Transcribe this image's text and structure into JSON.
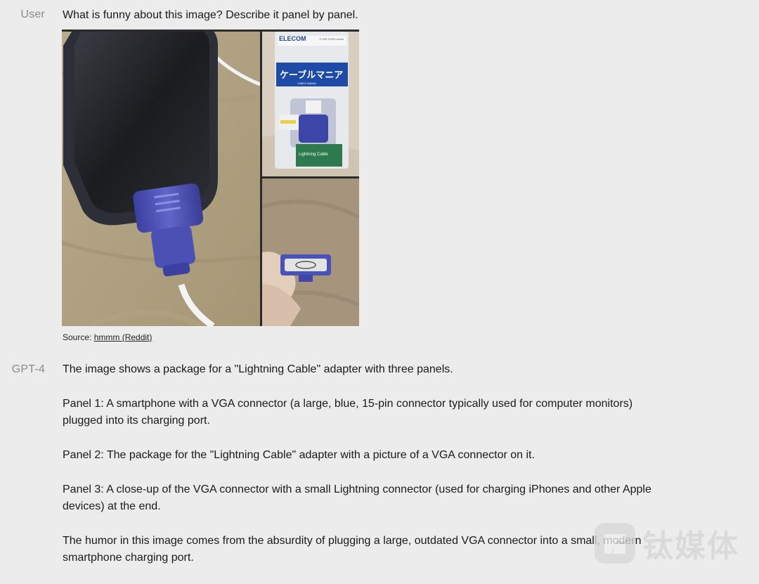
{
  "user_message": {
    "role": "User",
    "text": "What is funny about this image? Describe it panel by panel.",
    "image": {
      "panels": [
        "phone-with-vga-connector",
        "cable-package",
        "connector-closeup"
      ],
      "package_brand": "ELECOM",
      "package_title": "ケーブルマニア",
      "package_subtitle": "CABLE MANIA",
      "package_series": "P-APLTDCN series",
      "package_badge": "Lightning Cable"
    },
    "source_prefix": "Source: ",
    "source_link": "hmmm (Reddit)"
  },
  "assistant_message": {
    "role": "GPT-4",
    "paragraphs": [
      "The image shows a package for a \"Lightning Cable\" adapter with three panels.",
      "Panel 1: A smartphone with a VGA connector (a large, blue, 15-pin connector typically used for computer monitors) plugged into its charging port.",
      "Panel 2: The package for the \"Lightning Cable\" adapter with a picture of a VGA connector on it.",
      "Panel 3: A close-up of the VGA connector with a small Lightning connector (used for charging iPhones and other Apple devices) at the end.",
      "The humor in this image comes from the absurdity of plugging a large, outdated VGA connector into a small, modern smartphone charging port."
    ]
  },
  "watermark": {
    "text": "钛媒体"
  }
}
